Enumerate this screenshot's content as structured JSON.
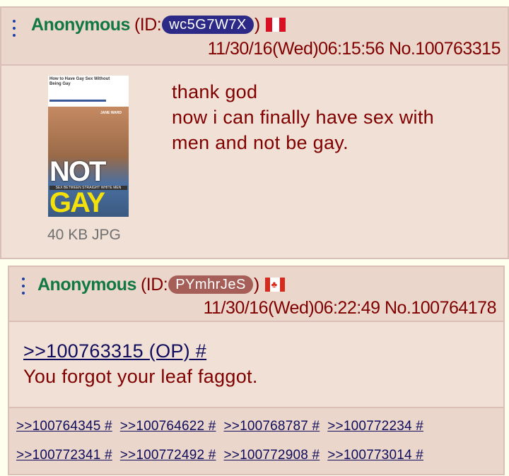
{
  "posts": [
    {
      "name": "Anonymous",
      "id_prefix": "(ID: ",
      "id": "wc5G7W7X",
      "id_color": "#2c2a86",
      "id_suffix": ")",
      "flag": "peru-flag-icon",
      "date": "11/30/16(Wed)06:15:56",
      "number": "No.100763315",
      "file_info": "40 KB JPG",
      "thumbnail": {
        "title": "How to Have Gay Sex Without Being Gay",
        "author": "JANE WARD",
        "big_text_1": "NOT",
        "subtitle": "SEX BETWEEN STRAIGHT WHITE MEN",
        "big_text_2": "GAY"
      },
      "comment_lines": [
        "thank god",
        "now i can finally have sex with",
        "men and not be gay."
      ]
    },
    {
      "name": "Anonymous",
      "id_prefix": "(ID: ",
      "id": "PYmhrJeS",
      "id_color": "#a55f58",
      "id_suffix": ")",
      "flag": "canada-flag-icon",
      "date": "11/30/16(Wed)06:22:49",
      "number": "No.100764178",
      "quote": ">>100763315 (OP) #",
      "comment_lines": [
        "You forgot your leaf faggot."
      ],
      "backlinks": [
        ">>100764345 #",
        ">>100764622 #",
        ">>100768787 #",
        ">>100772234 #",
        ">>100772341 #",
        ">>100772492 #",
        ">>100772908 #",
        ">>100773014 #"
      ]
    }
  ],
  "colors": {
    "background": "#ffffee",
    "post_bg": "#f0e0d6",
    "name_green": "#117743",
    "text_maroon": "#800000",
    "link_blue": "#0f0c5d"
  }
}
